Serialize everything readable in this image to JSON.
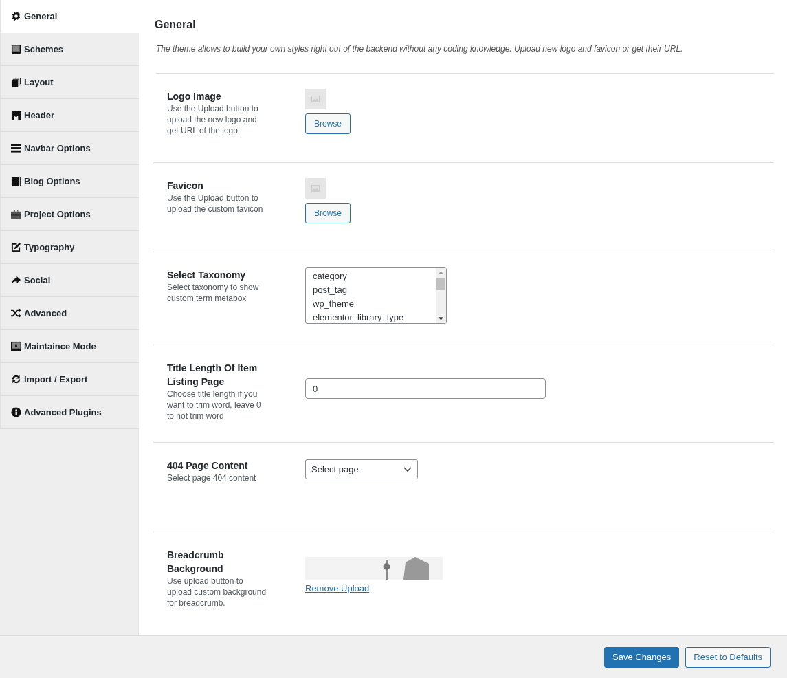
{
  "sidebar": {
    "items": [
      {
        "label": "General",
        "selected": true
      },
      {
        "label": "Schemes",
        "selected": false
      },
      {
        "label": "Layout",
        "selected": false
      },
      {
        "label": "Header",
        "selected": false
      },
      {
        "label": "Navbar Options",
        "selected": false
      },
      {
        "label": "Blog Options",
        "selected": false
      },
      {
        "label": "Project Options",
        "selected": false
      },
      {
        "label": "Typography",
        "selected": false
      },
      {
        "label": "Social",
        "selected": false
      },
      {
        "label": "Advanced",
        "selected": false
      },
      {
        "label": "Maintaince Mode",
        "selected": false
      },
      {
        "label": "Import / Export",
        "selected": false
      },
      {
        "label": "Advanced Plugins",
        "selected": false
      }
    ]
  },
  "content": {
    "title": "General",
    "description": "The theme allows to build your own styles right out of the backend without any coding knowledge. Upload new logo and favicon or get their URL.",
    "settings": [
      {
        "kind": "image-upload",
        "label": "Logo Image",
        "help": "Use the Upload button to upload the new logo and get URL of the logo",
        "button": "Browse"
      },
      {
        "kind": "image-upload",
        "label": "Favicon",
        "help": "Use the Upload button to upload the custom favicon",
        "button": "Browse"
      },
      {
        "kind": "listbox",
        "label": "Select Taxonomy",
        "help": "Select taxonomy to show custom term metabox",
        "options": [
          "category",
          "post_tag",
          "wp_theme",
          "elementor_library_type"
        ]
      },
      {
        "kind": "text-input",
        "label": "Title Length Of Item Listing Page",
        "help": "Choose title length if you want to trim word, leave 0 to not trim word",
        "value": "0"
      },
      {
        "kind": "select",
        "label": "404 Page Content",
        "help": "Select page 404 content",
        "value": "Select page"
      },
      {
        "kind": "background-upload",
        "label": "Breadcrumb Background",
        "help": "Use upload button to upload custom background for breadcrumb.",
        "link": "Remove Upload"
      }
    ]
  },
  "footer": {
    "buttons": [
      {
        "label": "Save Changes",
        "kind": "primary"
      },
      {
        "label": "Reset to Defaults",
        "kind": "secondary"
      }
    ]
  }
}
